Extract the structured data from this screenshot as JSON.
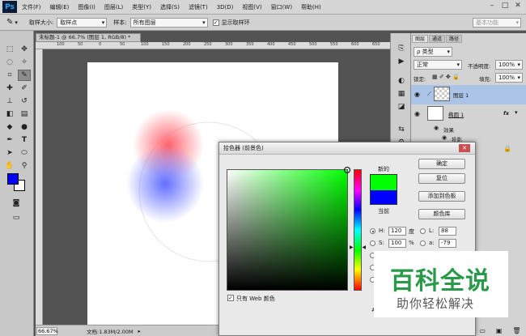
{
  "app": {
    "logo": "Ps"
  },
  "menu": [
    "文件(F)",
    "编辑(E)",
    "图像(I)",
    "图层(L)",
    "类型(Y)",
    "选择(S)",
    "滤镜(T)",
    "3D(D)",
    "视图(V)",
    "窗口(W)",
    "帮助(H)"
  ],
  "window_controls": {
    "min": "–",
    "max": "□",
    "close": "✕"
  },
  "options": {
    "sample_size_label": "取样大小:",
    "sample_size_value": "取样点",
    "sample_label": "样本:",
    "sample_value": "所有图层",
    "show_ring_label": "显示取样环",
    "workspace": "基本功能"
  },
  "document": {
    "tab_title": "未标题-1 @ 66.7% (图层 1, RGB/8) *",
    "zoom": "66.67%",
    "doc_info": "文档:1.83M/2.00M",
    "ruler_ticks": [
      "100",
      "50",
      "0",
      "50",
      "100",
      "150",
      "200",
      "250",
      "300",
      "350",
      "400",
      "450",
      "500",
      "550",
      "600",
      "650"
    ]
  },
  "layers_panel": {
    "tabs": [
      "图层",
      "通道",
      "路径"
    ],
    "kind_filter": "ρ 类型",
    "blend_mode": "正常",
    "opacity_label": "不透明度:",
    "opacity_value": "100%",
    "lock_label": "锁定:",
    "fill_label": "填充:",
    "fill_value": "100%",
    "layers": [
      {
        "name": "图层 1",
        "selected": true
      },
      {
        "name": "椭圆 1",
        "fx": "fx"
      }
    ],
    "effects_label": "效果",
    "effect_item": "投影"
  },
  "color_picker": {
    "title": "拾色器 (前景色)",
    "new_label": "新的",
    "current_label": "当前",
    "buttons": {
      "ok": "确定",
      "reset": "复位",
      "add_swatch": "添加到色板",
      "libraries": "颜色库"
    },
    "fields": [
      {
        "label": "H:",
        "value": "120",
        "unit": "度",
        "selected": true
      },
      {
        "label": "S:",
        "value": "100",
        "unit": "%",
        "selected": false
      }
    ],
    "lab_fields": [
      {
        "label": "L:",
        "value": "88"
      },
      {
        "label": "a:",
        "value": "-79"
      }
    ],
    "web_only_label": "只有 Web 颜色",
    "colors": {
      "new": "#00ff00",
      "current": "#0000ff",
      "hash_prefix": "#"
    }
  },
  "foreground_color": "#0000ff",
  "background_color": "#ffffff",
  "watermark": {
    "title": "百科全说",
    "subtitle": "助你轻松解决"
  }
}
